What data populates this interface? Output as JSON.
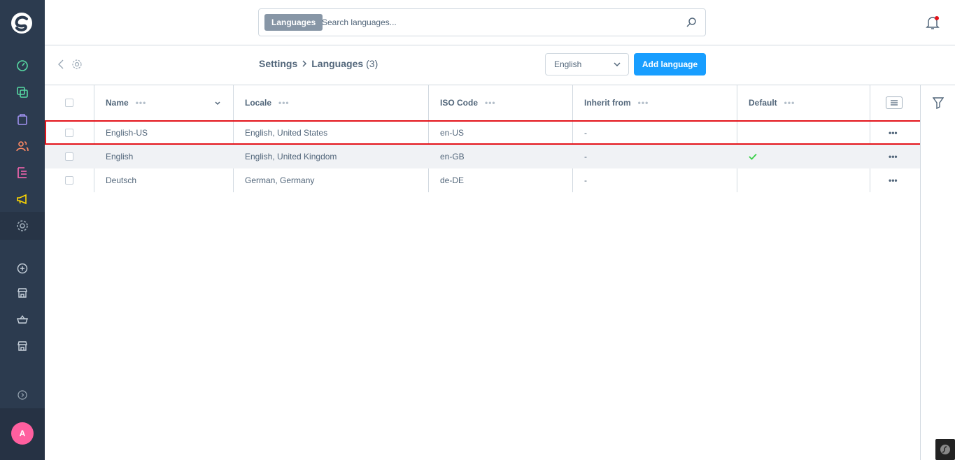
{
  "search": {
    "badge": "Languages",
    "placeholder": "Search languages..."
  },
  "breadcrumb": {
    "parent": "Settings",
    "current": "Languages",
    "count": "(3)"
  },
  "smartbar": {
    "language_select": "English",
    "add_button": "Add language"
  },
  "grid": {
    "columns": [
      "Name",
      "Locale",
      "ISO Code",
      "Inherit from",
      "Default"
    ],
    "rows": [
      {
        "name": "English-US",
        "locale": "English, United States",
        "iso": "en-US",
        "inherit": "-",
        "default": ""
      },
      {
        "name": "English",
        "locale": "English, United Kingdom",
        "iso": "en-GB",
        "inherit": "-",
        "default": "check"
      },
      {
        "name": "Deutsch",
        "locale": "German, Germany",
        "iso": "de-DE",
        "inherit": "-",
        "default": ""
      }
    ],
    "actions_label": "•••",
    "header_dots": "•••"
  },
  "user": {
    "avatar_initial": "A"
  },
  "colors": {
    "sidebar": "#2c3b4f",
    "accent": "#189eff",
    "highlight": "#e3131a",
    "check": "#37d046",
    "avatar": "#ff5f9f"
  }
}
